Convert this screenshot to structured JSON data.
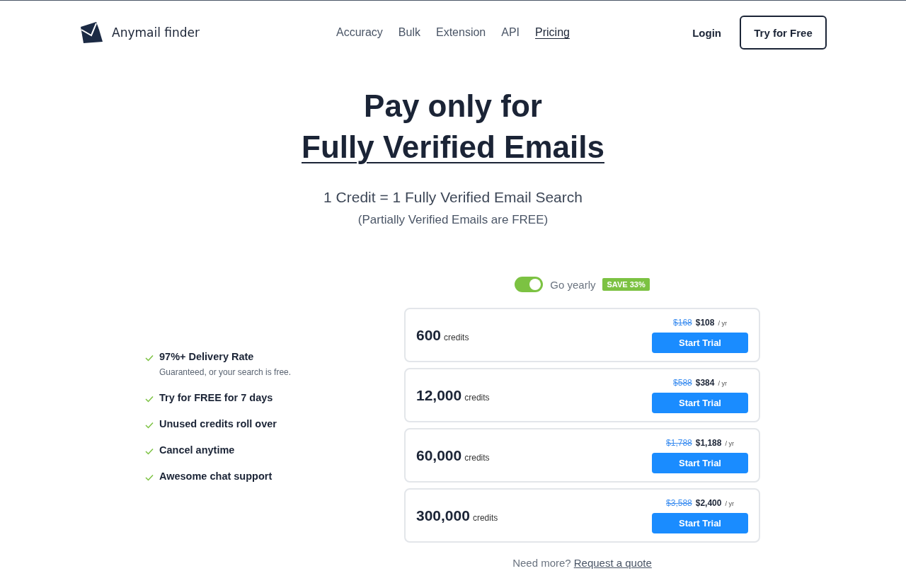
{
  "header": {
    "brand": "Anymail finder",
    "nav": [
      {
        "label": "Accuracy",
        "selected": false
      },
      {
        "label": "Bulk",
        "selected": false
      },
      {
        "label": "Extension",
        "selected": false
      },
      {
        "label": "API",
        "selected": false
      },
      {
        "label": "Pricing",
        "selected": true
      }
    ],
    "login": "Login",
    "cta": "Try for Free"
  },
  "hero": {
    "title_line1": "Pay only for",
    "title_line2": "Fully Verified Emails",
    "subtitle": "1 Credit = 1 Fully Verified Email Search",
    "note": "(Partially Verified Emails are FREE)"
  },
  "billing": {
    "on": true,
    "label": "Go yearly",
    "badge": "SAVE 33%"
  },
  "features": [
    {
      "title": "97%+ Delivery Rate",
      "note": "Guaranteed, or your search is free."
    },
    {
      "title": "Try for FREE for 7 days"
    },
    {
      "title": "Unused credits roll over"
    },
    {
      "title": "Cancel anytime"
    },
    {
      "title": "Awesome chat support"
    }
  ],
  "plans": [
    {
      "credits": "600",
      "unit": "credits",
      "old_price": "$168",
      "price": "$108",
      "period": "/ yr",
      "button": "Start Trial"
    },
    {
      "credits": "12,000",
      "unit": "credits",
      "old_price": "$588",
      "price": "$384",
      "period": "/ yr",
      "button": "Start Trial"
    },
    {
      "credits": "60,000",
      "unit": "credits",
      "old_price": "$1,788",
      "price": "$1,188",
      "period": "/ yr",
      "button": "Start Trial"
    },
    {
      "credits": "300,000",
      "unit": "credits",
      "old_price": "$3,588",
      "price": "$2,400",
      "period": "/ yr",
      "button": "Start Trial"
    }
  ],
  "footer": {
    "text": "Need more?",
    "link": "Request a quote"
  }
}
